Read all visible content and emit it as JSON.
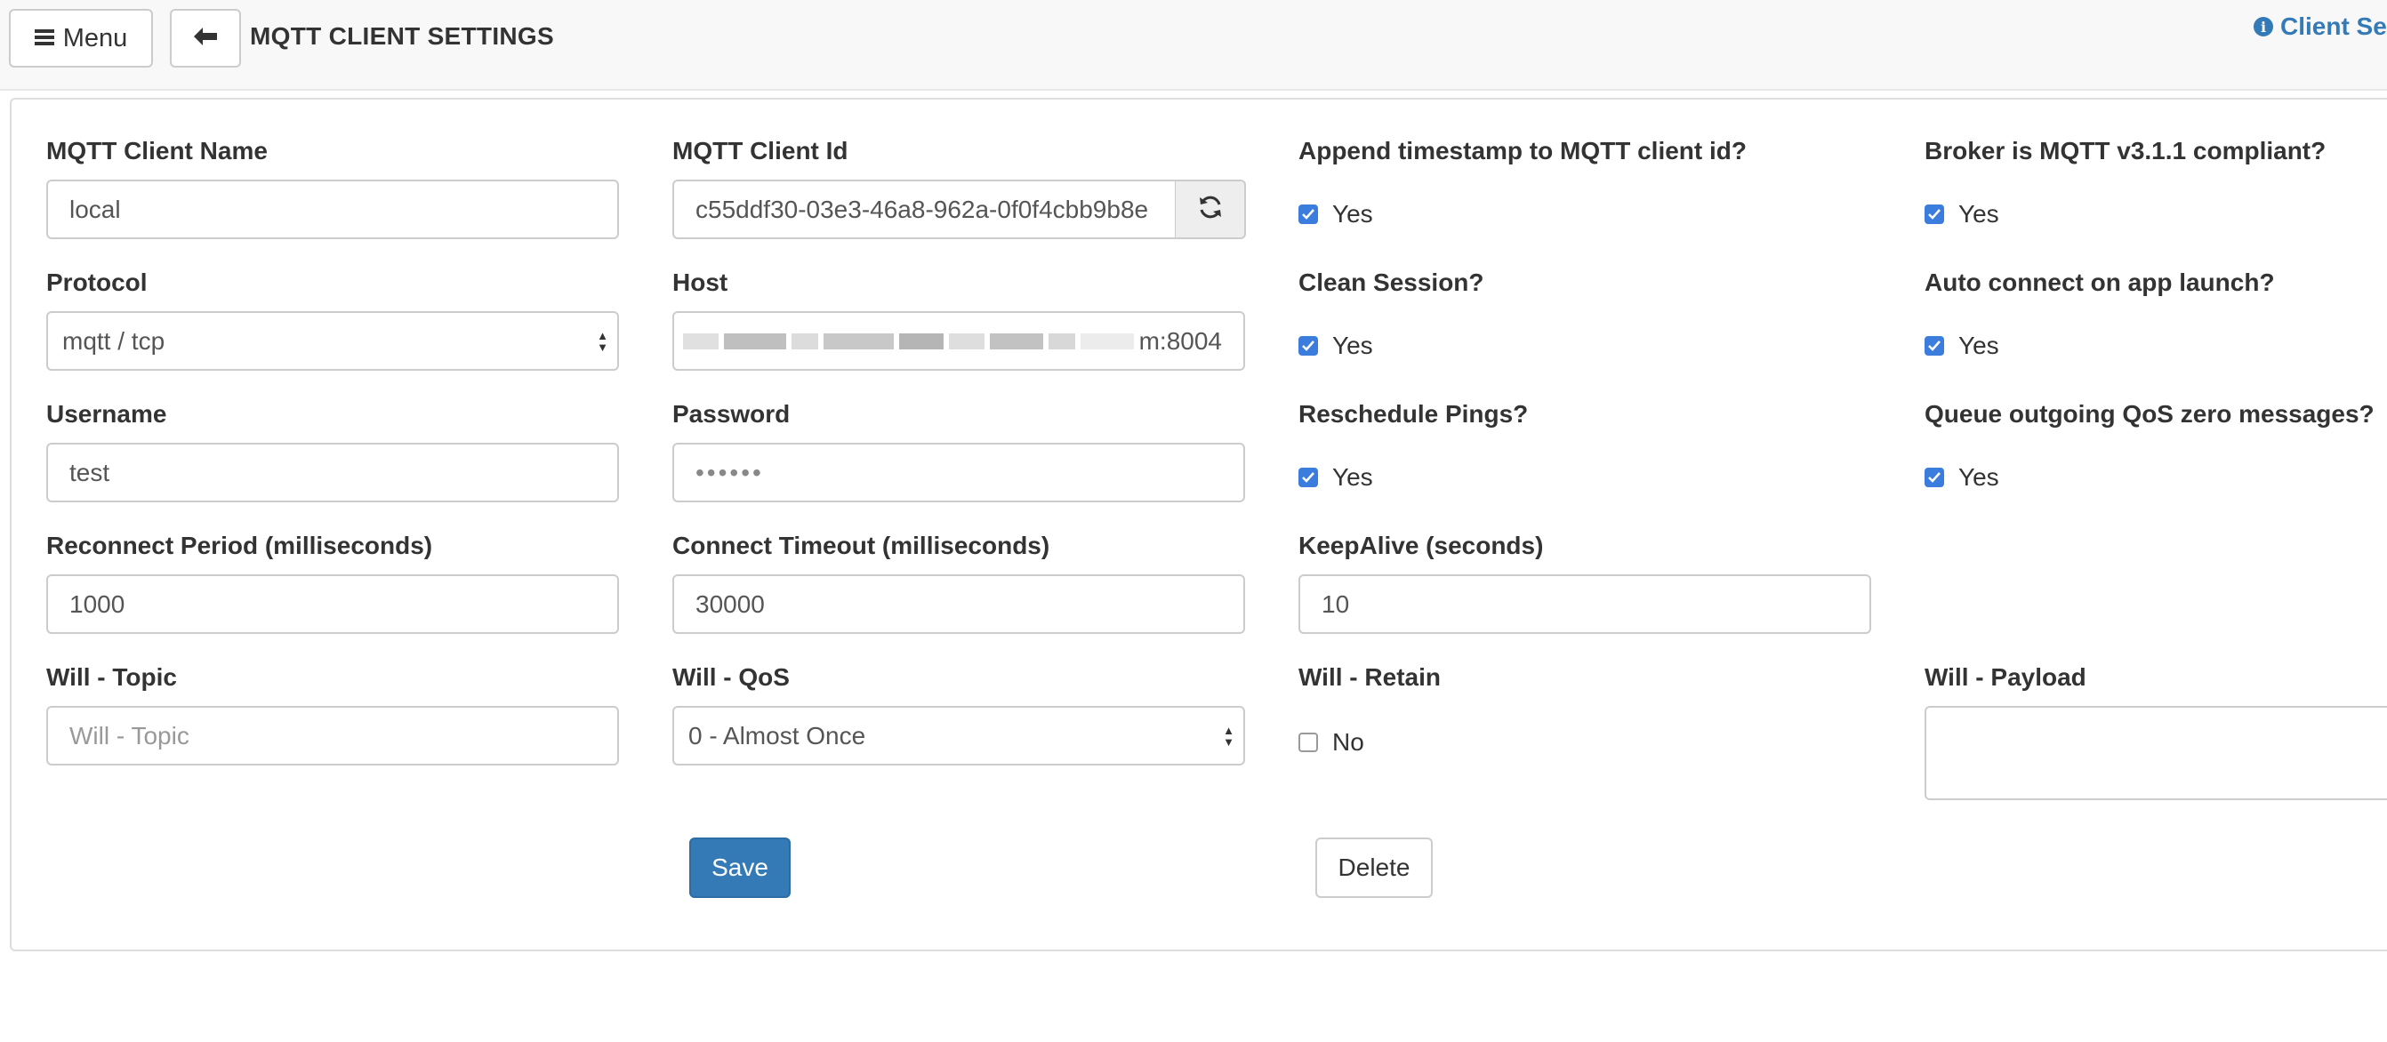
{
  "header": {
    "menu_label": "Menu",
    "page_title": "MQTT CLIENT SETTINGS",
    "client_link_label": "Client Se"
  },
  "form": {
    "client_name": {
      "label": "MQTT Client Name",
      "value": "local"
    },
    "client_id": {
      "label": "MQTT Client Id",
      "value": "c55ddf30-03e3-46a8-962a-0f0f4cbb9b8e"
    },
    "append_timestamp": {
      "label": "Append timestamp to MQTT client id?",
      "checked": true,
      "text": "Yes"
    },
    "broker_compliant": {
      "label": "Broker is MQTT v3.1.1 compliant?",
      "checked": true,
      "text": "Yes"
    },
    "protocol": {
      "label": "Protocol",
      "value": "mqtt / tcp"
    },
    "host": {
      "label": "Host",
      "value_visible_suffix": "m:8004"
    },
    "clean_session": {
      "label": "Clean Session?",
      "checked": true,
      "text": "Yes"
    },
    "auto_connect": {
      "label": "Auto connect on app launch?",
      "checked": true,
      "text": "Yes"
    },
    "username": {
      "label": "Username",
      "value": "test"
    },
    "password": {
      "label": "Password",
      "masked": "••••••"
    },
    "reschedule_pings": {
      "label": "Reschedule Pings?",
      "checked": true,
      "text": "Yes"
    },
    "queue_qos_zero": {
      "label": "Queue outgoing QoS zero messages?",
      "checked": true,
      "text": "Yes"
    },
    "reconnect_period": {
      "label": "Reconnect Period (milliseconds)",
      "value": "1000"
    },
    "connect_timeout": {
      "label": "Connect Timeout (milliseconds)",
      "value": "30000"
    },
    "keepalive": {
      "label": "KeepAlive (seconds)",
      "value": "10"
    },
    "will_topic": {
      "label": "Will - Topic",
      "placeholder": "Will - Topic"
    },
    "will_qos": {
      "label": "Will - QoS",
      "value": "0 - Almost Once"
    },
    "will_retain": {
      "label": "Will - Retain",
      "checked": false,
      "text": "No"
    },
    "will_payload": {
      "label": "Will - Payload",
      "value": ""
    }
  },
  "actions": {
    "save_label": "Save",
    "delete_label": "Delete"
  },
  "colors": {
    "primary": "#337ab7",
    "checkbox": "#3b7ddd",
    "navbar_bg": "#f8f8f8"
  }
}
